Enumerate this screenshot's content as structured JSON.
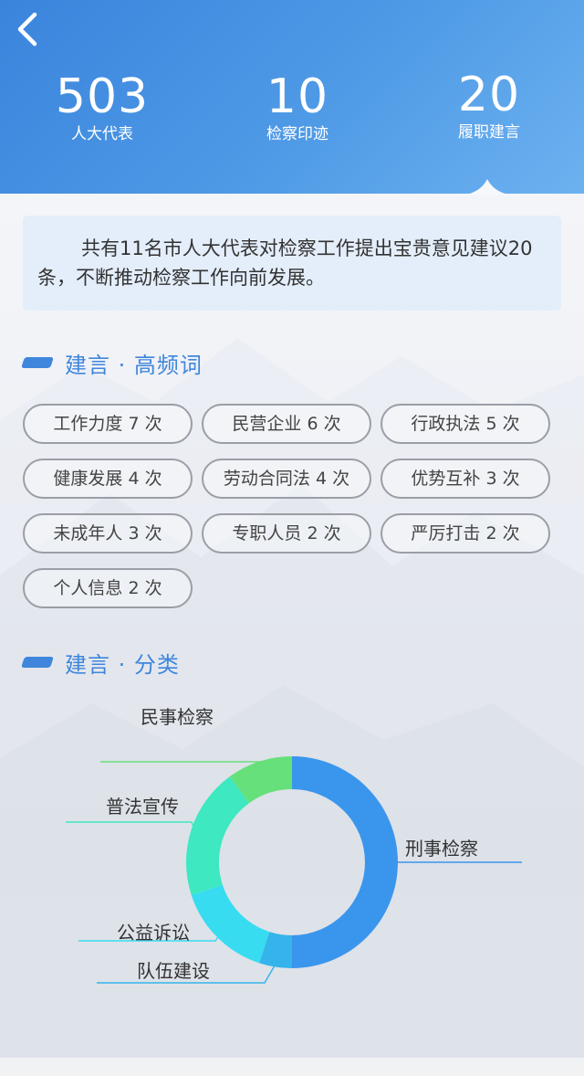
{
  "header": {
    "stats": [
      {
        "value": "503",
        "label": "人大代表"
      },
      {
        "value": "10",
        "label": "检察印迹"
      },
      {
        "value": "20",
        "label": "履职建言"
      }
    ],
    "active_stat_index": 2
  },
  "intro": {
    "text": "共有11名市人大代表对检察工作提出宝贵意见建议20条，不断推动检察工作向前发展。"
  },
  "sections": {
    "keywords_title": "建言 · 高频词",
    "category_title": "建言 · 分类"
  },
  "keywords": [
    "工作力度 7 次",
    "民营企业 6 次",
    "行政执法 5 次",
    "健康发展 4 次",
    "劳动合同法 4 次",
    "优势互补 3 次",
    "未成年人 3 次",
    "专职人员 2 次",
    "严厉打击 2 次",
    "个人信息 2 次"
  ],
  "chart_data": {
    "type": "pie",
    "variant": "donut",
    "slices": [
      {
        "label": "刑事检察",
        "value": 10,
        "color": "#3a96ec"
      },
      {
        "label": "队伍建设",
        "value": 1,
        "color": "#34b4ea"
      },
      {
        "label": "公益诉讼",
        "value": 3,
        "color": "#38dcf0"
      },
      {
        "label": "普法宣传",
        "value": 4,
        "color": "#3ee8c0"
      },
      {
        "label": "民事检察",
        "value": 2,
        "color": "#66e07a"
      }
    ]
  },
  "colors": {
    "accent": "#3f86dc",
    "header_start": "#3a84dd",
    "header_end": "#6cb2f0"
  },
  "icons": {
    "back": "chevron-left-icon"
  }
}
